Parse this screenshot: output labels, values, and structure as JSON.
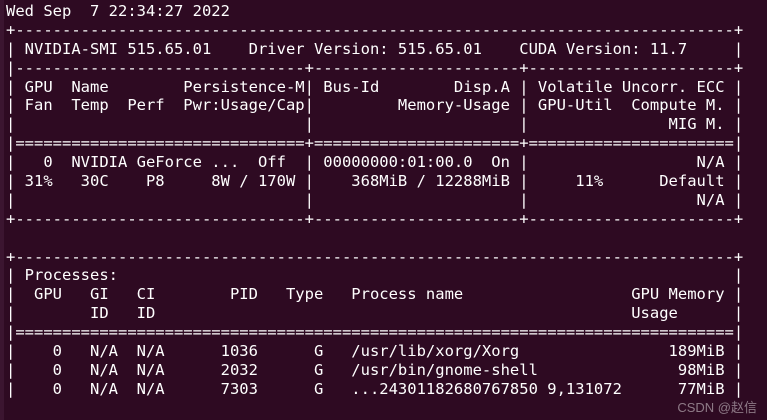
{
  "window": {
    "theme_background": "#2e0a22",
    "text_color": "#ffffff"
  },
  "terminal": {
    "lines": [
      "Wed Sep  7 22:34:27 2022",
      "+-----------------------------------------------------------------------------+",
      "| NVIDIA-SMI 515.65.01    Driver Version: 515.65.01    CUDA Version: 11.7     |",
      "|-------------------------------+----------------------+----------------------+",
      "| GPU  Name        Persistence-M| Bus-Id        Disp.A | Volatile Uncorr. ECC |",
      "| Fan  Temp  Perf  Pwr:Usage/Cap|         Memory-Usage | GPU-Util  Compute M. |",
      "|                               |                      |               MIG M. |",
      "|===============================+======================+======================|",
      "|   0  NVIDIA GeForce ...  Off  | 00000000:01:00.0  On |                  N/A |",
      "| 31%   30C    P8     8W / 170W |    368MiB / 12288MiB |     11%      Default |",
      "|                               |                      |                  N/A |",
      "+-------------------------------+----------------------+----------------------+",
      "",
      "+-----------------------------------------------------------------------------+",
      "| Processes:                                                                  |",
      "|  GPU   GI   CI        PID   Type   Process name                  GPU Memory |",
      "|        ID   ID                                                   Usage      |",
      "|=============================================================================|",
      "|    0   N/A  N/A      1036      G   /usr/lib/xorg/Xorg                189MiB |",
      "|    0   N/A  N/A      2032      G   /usr/bin/gnome-shell               98MiB |",
      "|    0   N/A  N/A      7303      G   ...24301182680767850 9,131072      77MiB |"
    ]
  },
  "watermark": "CSDN @赵信"
}
